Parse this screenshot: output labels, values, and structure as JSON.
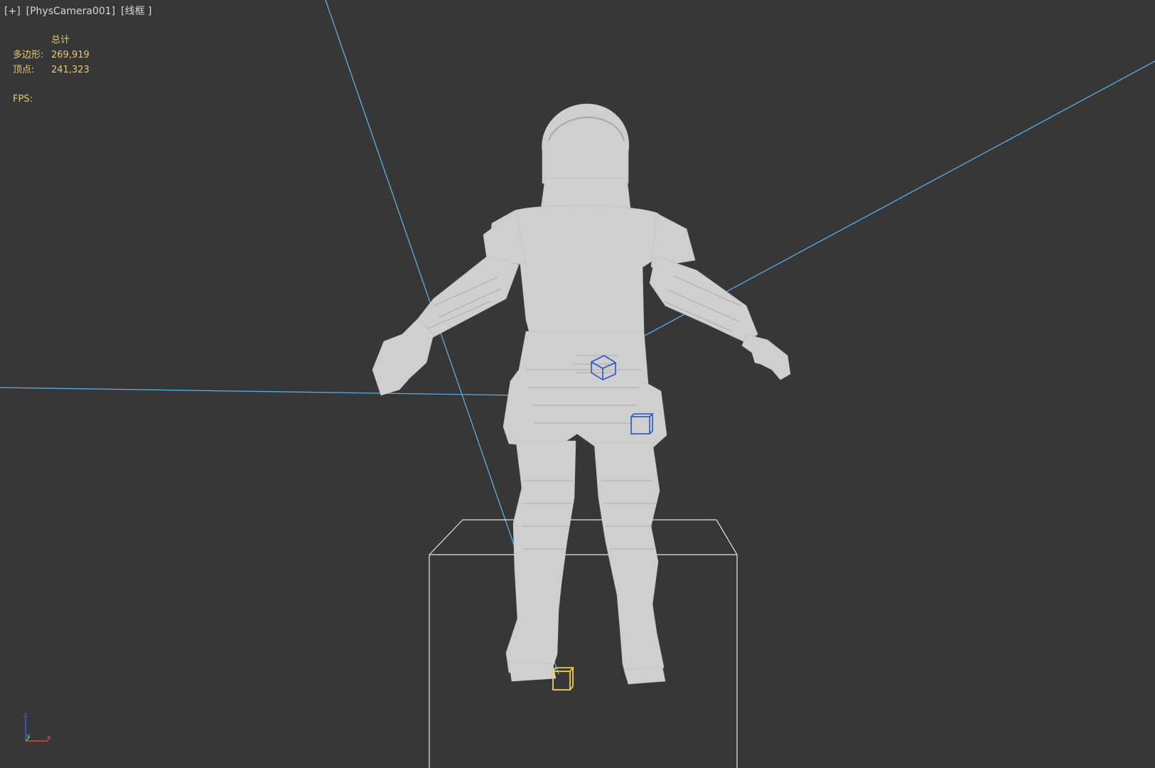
{
  "viewport": {
    "menu_label": "[+]",
    "camera_label": "[PhysCamera001]",
    "shading_label": "[线框 ]"
  },
  "stats": {
    "header": "总计",
    "polygons_label": "多边形:",
    "polygons_value": "269,919",
    "vertices_label": "顶点:",
    "vertices_value": "241,323",
    "fps_label": "FPS:"
  },
  "axis": {
    "z": "z",
    "y": "y",
    "x": "x"
  },
  "colors": {
    "background": "#373737",
    "mesh": "#cfcfcf",
    "camera_lines": "#59aee8",
    "selection_box": "#f1d42c",
    "helper_cube": "#2855c7",
    "stats_text": "#e5c96b"
  }
}
